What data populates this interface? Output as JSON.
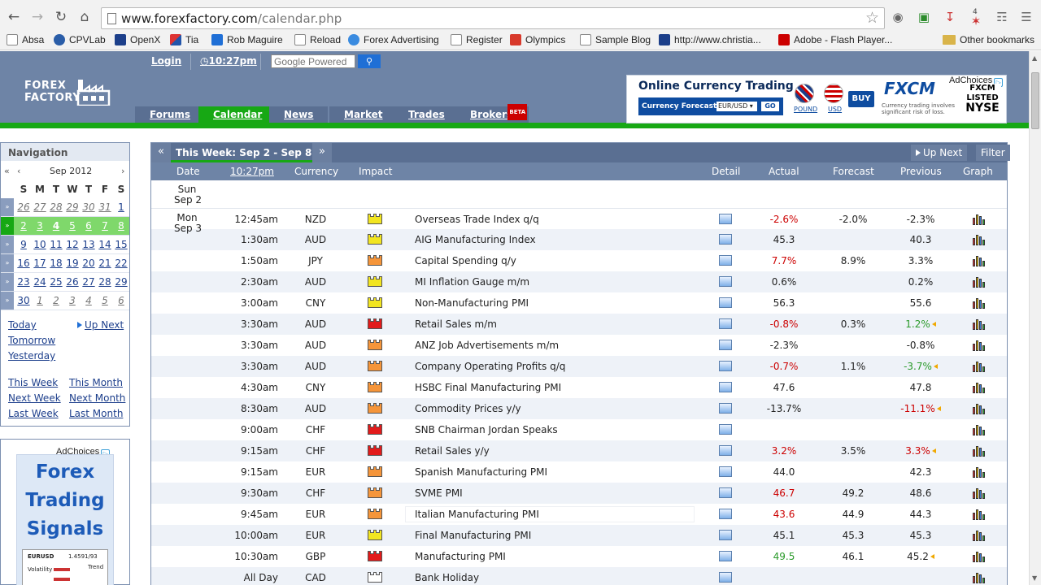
{
  "browser": {
    "url_domain": "www.forexfactory.com",
    "url_path": "/calendar.php",
    "ext_badge": "4",
    "bookmarks": [
      {
        "label": "Absa"
      },
      {
        "label": "CPVLab"
      },
      {
        "label": "OpenX"
      },
      {
        "label": "Tia"
      },
      {
        "label": "Rob Maguire"
      },
      {
        "label": "Reload"
      },
      {
        "label": "Forex Advertising"
      },
      {
        "label": "Register"
      },
      {
        "label": "Olympics"
      },
      {
        "label": "Sample Blog"
      },
      {
        "label": "http://www.christia..."
      },
      {
        "label": "Adobe - Flash Player..."
      }
    ],
    "other_bookmarks": "Other bookmarks"
  },
  "header": {
    "logo_line1": "FOREX",
    "logo_line2": "FACTORY",
    "login": "Login",
    "time": "10:27pm",
    "search_placeholder": "Google Powered",
    "tabs": [
      "Forums",
      "Calendar",
      "News",
      "Market",
      "Trades",
      "Brokers"
    ],
    "tab_badge": "BETA"
  },
  "ad_top": {
    "adchoices": "AdChoices",
    "title": "Online Currency Trading",
    "forecast_label": "Currency Forecast",
    "pair": "EUR/USD",
    "go": "GO",
    "flag1": "POUND",
    "flag2": "USD",
    "buy": "BUY",
    "brand": "FXCM",
    "disclaimer": "Currency trading involves significant risk of loss.",
    "nyse_line1": "FXCM",
    "nyse_line2": "LISTED",
    "nyse_line3": "NYSE"
  },
  "navigation": {
    "title": "Navigation",
    "month": "Sep 2012",
    "dow": [
      "S",
      "M",
      "T",
      "W",
      "T",
      "F",
      "S"
    ],
    "weeks": [
      [
        "26",
        "27",
        "28",
        "29",
        "30",
        "31",
        "1"
      ],
      [
        "2",
        "3",
        "4",
        "5",
        "6",
        "7",
        "8"
      ],
      [
        "9",
        "10",
        "11",
        "12",
        "13",
        "14",
        "15"
      ],
      [
        "16",
        "17",
        "18",
        "19",
        "20",
        "21",
        "22"
      ],
      [
        "23",
        "24",
        "25",
        "26",
        "27",
        "28",
        "29"
      ],
      [
        "30",
        "1",
        "2",
        "3",
        "4",
        "5",
        "6"
      ]
    ],
    "today": "Today",
    "up_next": "Up Next",
    "tomorrow": "Tomorrow",
    "yesterday": "Yesterday",
    "this_week": "This Week",
    "this_month": "This Month",
    "next_week": "Next Week",
    "next_month": "Next Month",
    "last_week": "Last Week",
    "last_month": "Last Month"
  },
  "ad_left": {
    "adchoices": "AdChoices",
    "title": "Forex Trading Signals",
    "pair": "EURUSD",
    "price": "1.4591/93",
    "label1": "Volatility",
    "label2": "Trend"
  },
  "calendar": {
    "week_title": "This Week: Sep 2 - Sep 8",
    "up_next": "Up Next",
    "filter": "Filter",
    "columns": {
      "date": "Date",
      "time": "10:27pm",
      "currency": "Currency",
      "impact": "Impact",
      "detail": "Detail",
      "actual": "Actual",
      "forecast": "Forecast",
      "previous": "Previous",
      "graph": "Graph"
    },
    "sun_day": "Sun",
    "sun_date": "Sep 2",
    "mon_day": "Mon",
    "mon_date": "Sep 3",
    "rows": [
      {
        "time": "12:45am",
        "currency": "NZD",
        "impact": "low",
        "event": "Overseas Trade Index q/q",
        "actual": "-2.6%",
        "actual_color": "red",
        "forecast": "-2.0%",
        "previous": "-2.3%",
        "prev_color": "",
        "revised": false
      },
      {
        "time": "1:30am",
        "currency": "AUD",
        "impact": "low",
        "event": "AIG Manufacturing Index",
        "actual": "45.3",
        "actual_color": "",
        "forecast": "",
        "previous": "40.3",
        "prev_color": "",
        "revised": false
      },
      {
        "time": "1:50am",
        "currency": "JPY",
        "impact": "med",
        "event": "Capital Spending q/y",
        "actual": "7.7%",
        "actual_color": "red",
        "forecast": "8.9%",
        "previous": "3.3%",
        "prev_color": "",
        "revised": false
      },
      {
        "time": "2:30am",
        "currency": "AUD",
        "impact": "low",
        "event": "MI Inflation Gauge m/m",
        "actual": "0.6%",
        "actual_color": "",
        "forecast": "",
        "previous": "0.2%",
        "prev_color": "",
        "revised": false
      },
      {
        "time": "3:00am",
        "currency": "CNY",
        "impact": "low",
        "event": "Non-Manufacturing PMI",
        "actual": "56.3",
        "actual_color": "",
        "forecast": "",
        "previous": "55.6",
        "prev_color": "",
        "revised": false
      },
      {
        "time": "3:30am",
        "currency": "AUD",
        "impact": "high",
        "event": "Retail Sales m/m",
        "actual": "-0.8%",
        "actual_color": "red",
        "forecast": "0.3%",
        "previous": "1.2%",
        "prev_color": "grn",
        "revised": true
      },
      {
        "time": "3:30am",
        "currency": "AUD",
        "impact": "med",
        "event": "ANZ Job Advertisements m/m",
        "actual": "-2.3%",
        "actual_color": "",
        "forecast": "",
        "previous": "-0.8%",
        "prev_color": "",
        "revised": false
      },
      {
        "time": "3:30am",
        "currency": "AUD",
        "impact": "med",
        "event": "Company Operating Profits q/q",
        "actual": "-0.7%",
        "actual_color": "red",
        "forecast": "1.1%",
        "previous": "-3.7%",
        "prev_color": "grn",
        "revised": true
      },
      {
        "time": "4:30am",
        "currency": "CNY",
        "impact": "med",
        "event": "HSBC Final Manufacturing PMI",
        "actual": "47.6",
        "actual_color": "",
        "forecast": "",
        "previous": "47.8",
        "prev_color": "",
        "revised": false
      },
      {
        "time": "8:30am",
        "currency": "AUD",
        "impact": "med",
        "event": "Commodity Prices y/y",
        "actual": "-13.7%",
        "actual_color": "",
        "forecast": "",
        "previous": "-11.1%",
        "prev_color": "red",
        "revised": true
      },
      {
        "time": "9:00am",
        "currency": "CHF",
        "impact": "high",
        "event": "SNB Chairman Jordan Speaks",
        "actual": "",
        "actual_color": "",
        "forecast": "",
        "previous": "",
        "prev_color": "",
        "revised": false
      },
      {
        "time": "9:15am",
        "currency": "CHF",
        "impact": "high",
        "event": "Retail Sales y/y",
        "actual": "3.2%",
        "actual_color": "red",
        "forecast": "3.5%",
        "previous": "3.3%",
        "prev_color": "red",
        "revised": true
      },
      {
        "time": "9:15am",
        "currency": "EUR",
        "impact": "med",
        "event": "Spanish Manufacturing PMI",
        "actual": "44.0",
        "actual_color": "",
        "forecast": "",
        "previous": "42.3",
        "prev_color": "",
        "revised": false
      },
      {
        "time": "9:30am",
        "currency": "CHF",
        "impact": "med",
        "event": "SVME PMI",
        "actual": "46.7",
        "actual_color": "red",
        "forecast": "49.2",
        "previous": "48.6",
        "prev_color": "",
        "revised": false
      },
      {
        "time": "9:45am",
        "currency": "EUR",
        "impact": "med",
        "event": "Italian Manufacturing PMI",
        "actual": "43.6",
        "actual_color": "red",
        "forecast": "44.9",
        "previous": "44.3",
        "prev_color": "",
        "revised": false
      },
      {
        "time": "10:00am",
        "currency": "EUR",
        "impact": "low",
        "event": "Final Manufacturing PMI",
        "actual": "45.1",
        "actual_color": "",
        "forecast": "45.3",
        "previous": "45.3",
        "prev_color": "",
        "revised": false
      },
      {
        "time": "10:30am",
        "currency": "GBP",
        "impact": "high",
        "event": "Manufacturing PMI",
        "actual": "49.5",
        "actual_color": "grn",
        "forecast": "46.1",
        "previous": "45.2",
        "prev_color": "",
        "revised": true
      },
      {
        "time": "All Day",
        "currency": "CAD",
        "impact": "none",
        "event": "Bank Holiday",
        "actual": "",
        "actual_color": "",
        "forecast": "",
        "previous": "",
        "prev_color": "",
        "revised": false
      }
    ]
  }
}
